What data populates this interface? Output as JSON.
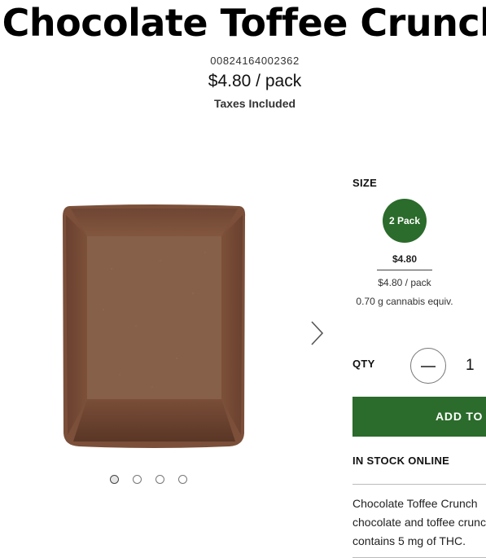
{
  "product": {
    "title": "Chocolate Toffee Crunch",
    "sku": "00824164002362",
    "price": "$4.80 / pack",
    "taxes_note": "Taxes Included"
  },
  "gallery": {
    "image_icon": "chocolate-bar-image",
    "next_icon": "chevron-right-icon",
    "slide_count": 4,
    "active_slide": 1
  },
  "size": {
    "label": "SIZE",
    "option_label": "2 Pack",
    "option_price": "$4.80",
    "option_unit_price": "$4.80 / pack",
    "option_equiv": "0.70 g cannabis equiv.",
    "option_color": "#2b6b2b"
  },
  "quantity": {
    "label": "QTY",
    "minus_icon": "minus-icon",
    "value": "1"
  },
  "cart": {
    "add_label": "ADD TO BAG",
    "button_color": "#2b6b2b"
  },
  "stock": {
    "status": "IN STOCK ONLINE"
  },
  "description": {
    "lines": [
      "Chocolate Toffee Crunch",
      "chocolate and toffee crunch",
      "contains 5 mg of THC."
    ]
  }
}
